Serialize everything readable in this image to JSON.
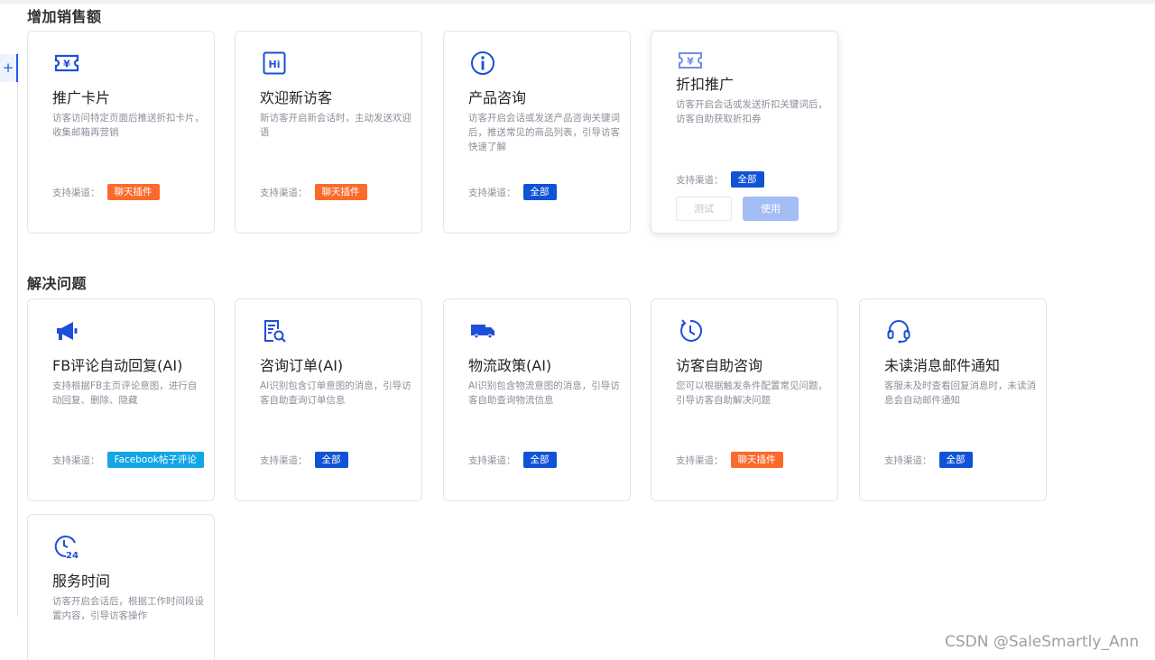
{
  "sections": {
    "sales": "增加销售额",
    "problems": "解决问题"
  },
  "sidebar": {
    "plus": "+"
  },
  "channel_label": "支持渠道：",
  "colors": {
    "orange": "#fa6a2b",
    "blue": "#1053d4",
    "cyan": "#12a6e6",
    "icon": "#1d4fd8"
  },
  "cards": [
    {
      "icon": "ticket-yen-icon",
      "title": "推广卡片",
      "desc": "访客访问特定页面后推送折扣卡片，收集邮箱再营销",
      "channel": "聊天插件",
      "channel_color": "orange"
    },
    {
      "icon": "hi-icon",
      "title": "欢迎新访客",
      "desc": "新访客开启新会话时，主动发送欢迎语",
      "channel": "聊天插件",
      "channel_color": "orange"
    },
    {
      "icon": "info-icon",
      "title": "产品咨询",
      "desc": "访客开启会话或发送产品咨询关键词后，推送常见的商品列表，引导访客快速了解",
      "channel": "全部",
      "channel_color": "blue"
    },
    {
      "icon": "ticket-yen-icon",
      "title": "折扣推广",
      "desc": "访客开启会话或发送折扣关键词后，访客自助获取折扣券",
      "channel": "全部",
      "channel_color": "blue",
      "test_label": "测试",
      "use_label": "使用"
    },
    {
      "icon": "megaphone-icon",
      "title": "FB评论自动回复(AI)",
      "desc": "支持根据FB主页评论意图，进行自动回复、删除、隐藏",
      "channel": "Facebook帖子评论",
      "channel_color": "cyan"
    },
    {
      "icon": "order-search-icon",
      "title": "咨询订单(AI)",
      "desc": "AI识别包含订单意图的消息，引导访客自助查询订单信息",
      "channel": "全部",
      "channel_color": "blue"
    },
    {
      "icon": "truck-icon",
      "title": "物流政策(AI)",
      "desc": "AI识别包含物流意图的消息，引导访客自助查询物流信息",
      "channel": "全部",
      "channel_color": "blue"
    },
    {
      "icon": "clock-refresh-icon",
      "title": "访客自助咨询",
      "desc": "您可以根据触发条件配置常见问题，引导访客自助解决问题",
      "channel": "聊天插件",
      "channel_color": "orange"
    },
    {
      "icon": "headset-icon",
      "title": "未读消息邮件通知",
      "desc": "客服未及时查看回复消息时，未读消息会自动邮件通知",
      "channel": "全部",
      "channel_color": "blue"
    },
    {
      "icon": "clock-24-icon",
      "title": "服务时间",
      "desc": "访客开启会话后，根据工作时间段设置内容，引导访客操作"
    }
  ],
  "watermark": "CSDN @SaleSmartly_Ann"
}
